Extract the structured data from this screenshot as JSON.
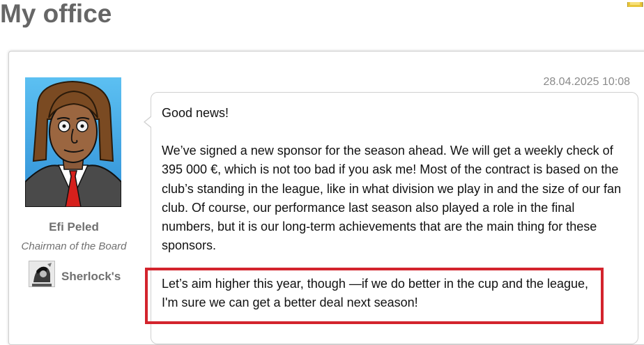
{
  "page": {
    "title": "My office"
  },
  "message": {
    "timestamp": "28.04.2025 10:08",
    "greeting": "Good news!",
    "body": "We’ve signed a new sponsor for the season ahead. We will get a weekly check of 395 000 €, which is not too bad if you ask me! Most of the contract is based on the club’s standing in the league, like in what division we play in and the size of our fan club. Of course, our performance last season also played a role in the final numbers, but it is our long-term achievements that are the main thing for these sponsors.",
    "closing": "Let’s aim higher this year, though —if we do better in the cup and the league, I'm sure we can get a better deal next season!"
  },
  "sender": {
    "name": "Efi Peled",
    "role": "Chairman of the Board",
    "avatar_icon": "chairman-portrait",
    "club": {
      "name": "Sherlock's",
      "logo_icon": "club-crest"
    }
  },
  "colors": {
    "highlight": "#d3242d",
    "title": "#666666",
    "avatar_bg": "#3fa9e8",
    "tie": "#d6201c"
  }
}
